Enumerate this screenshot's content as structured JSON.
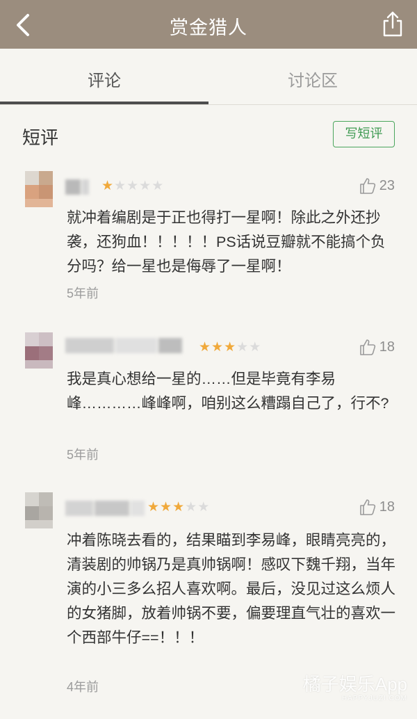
{
  "header": {
    "title": "赏金猎人",
    "back_icon": "chevron-left-icon",
    "share_icon": "share-icon"
  },
  "tabs": [
    {
      "label": "评论",
      "active": true
    },
    {
      "label": "讨论区",
      "active": false
    }
  ],
  "section": {
    "title": "短评",
    "write_button": "写短评"
  },
  "reviews": [
    {
      "rating": 1,
      "likes": "23",
      "content": "就冲着编剧是于正也得打一星啊！除此之外还抄袭，还狗血！！！！！PS话说豆瓣就不能搞个负分吗？给一星也是侮辱了一星啊！",
      "time": "5年前"
    },
    {
      "rating": 3,
      "likes": "18",
      "content": "我是真心想给一星的……但是毕竟有李易峰…………峰峰啊，咱别这么糟蹋自己了，行不?",
      "time": "5年前"
    },
    {
      "rating": 3,
      "likes": "18",
      "content": "冲着陈晓去看的，结果瞄到李易峰，眼睛亮亮的，清装剧的帅锅乃是真帅锅啊！感叹下魏千翔，当年演的小三多么招人喜欢啊。最后，没见过这么烦人的女猪脚，放着帅锅不要，偏要理直气壮的喜欢一个西部牛仔==！！！",
      "time": "4年前"
    }
  ],
  "watermark": {
    "main": "橘子娱乐App",
    "sub": "HAPPYJUZI.COM"
  },
  "colors": {
    "header_bg": "#9b8d7e",
    "page_bg": "#f6f5f1",
    "accent_green": "#4aa55c",
    "star_on": "#f0a93b",
    "star_off": "#dbdbdb"
  }
}
